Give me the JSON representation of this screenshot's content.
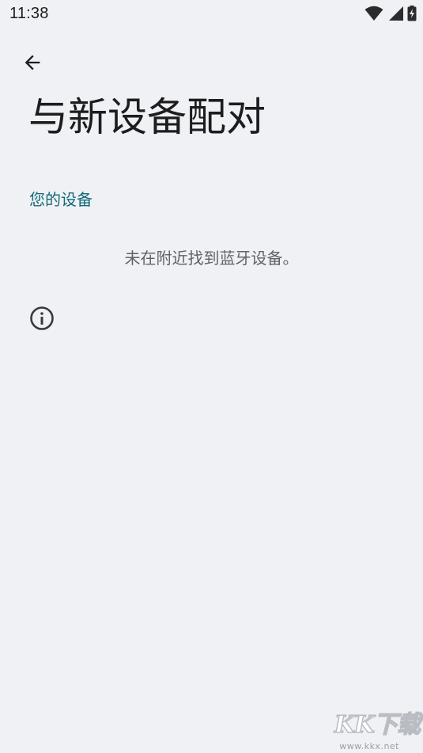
{
  "status_bar": {
    "time": "11:38",
    "icons": [
      "wifi-icon",
      "cellular-signal-icon",
      "battery-charging-icon"
    ]
  },
  "header": {
    "back_icon": "arrow-back-icon",
    "title": "与新设备配对"
  },
  "section": {
    "title": "您的设备",
    "empty_message": "未在附近找到蓝牙设备。"
  },
  "info": {
    "icon": "info-icon"
  },
  "watermark": {
    "logo_text": "KK下载",
    "url": "www.kkx.net"
  },
  "colors": {
    "background": "#f0f1f4",
    "accent": "#136a7a",
    "text_primary": "#1d1d1f",
    "text_secondary": "#5f6368"
  }
}
